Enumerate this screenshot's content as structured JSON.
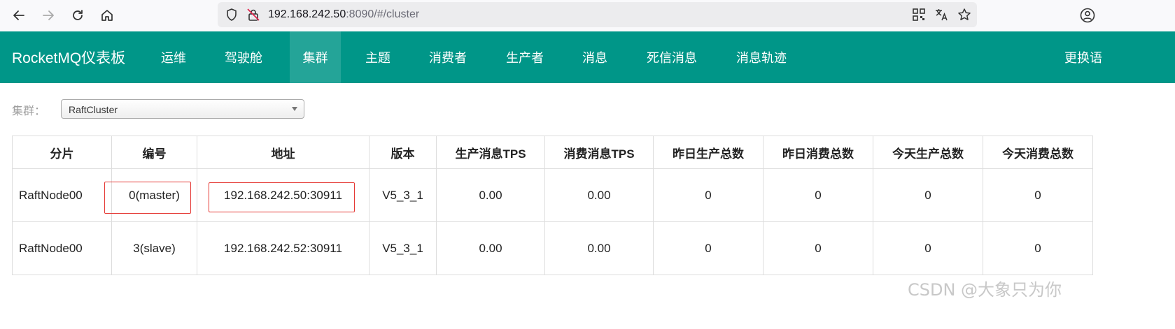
{
  "browser": {
    "url_host": "192.168.242.50",
    "url_rest": ":8090/#/cluster"
  },
  "app": {
    "brand": "RocketMQ仪表板",
    "nav": [
      "运维",
      "驾驶舱",
      "集群",
      "主题",
      "消费者",
      "生产者",
      "消息",
      "死信消息",
      "消息轨迹"
    ],
    "active_nav": "集群",
    "right_link": "更换语"
  },
  "cluster": {
    "label": "集群：",
    "selected": "RaftCluster"
  },
  "table": {
    "headers": [
      "分片",
      "编号",
      "地址",
      "版本",
      "生产消息TPS",
      "消费消息TPS",
      "昨日生产总数",
      "昨日消费总数",
      "今天生产总数",
      "今天消费总数"
    ],
    "rows": [
      [
        "RaftNode00",
        "0(master)",
        "192.168.242.50:30911",
        "V5_3_1",
        "0.00",
        "0.00",
        "0",
        "0",
        "0",
        "0"
      ],
      [
        "RaftNode00",
        "3(slave)",
        "192.168.242.52:30911",
        "V5_3_1",
        "0.00",
        "0.00",
        "0",
        "0",
        "0",
        "0"
      ]
    ]
  },
  "watermark": "CSDN @大象只为你",
  "colors": {
    "nav_bg": "#009688",
    "highlight": "#e53935"
  }
}
